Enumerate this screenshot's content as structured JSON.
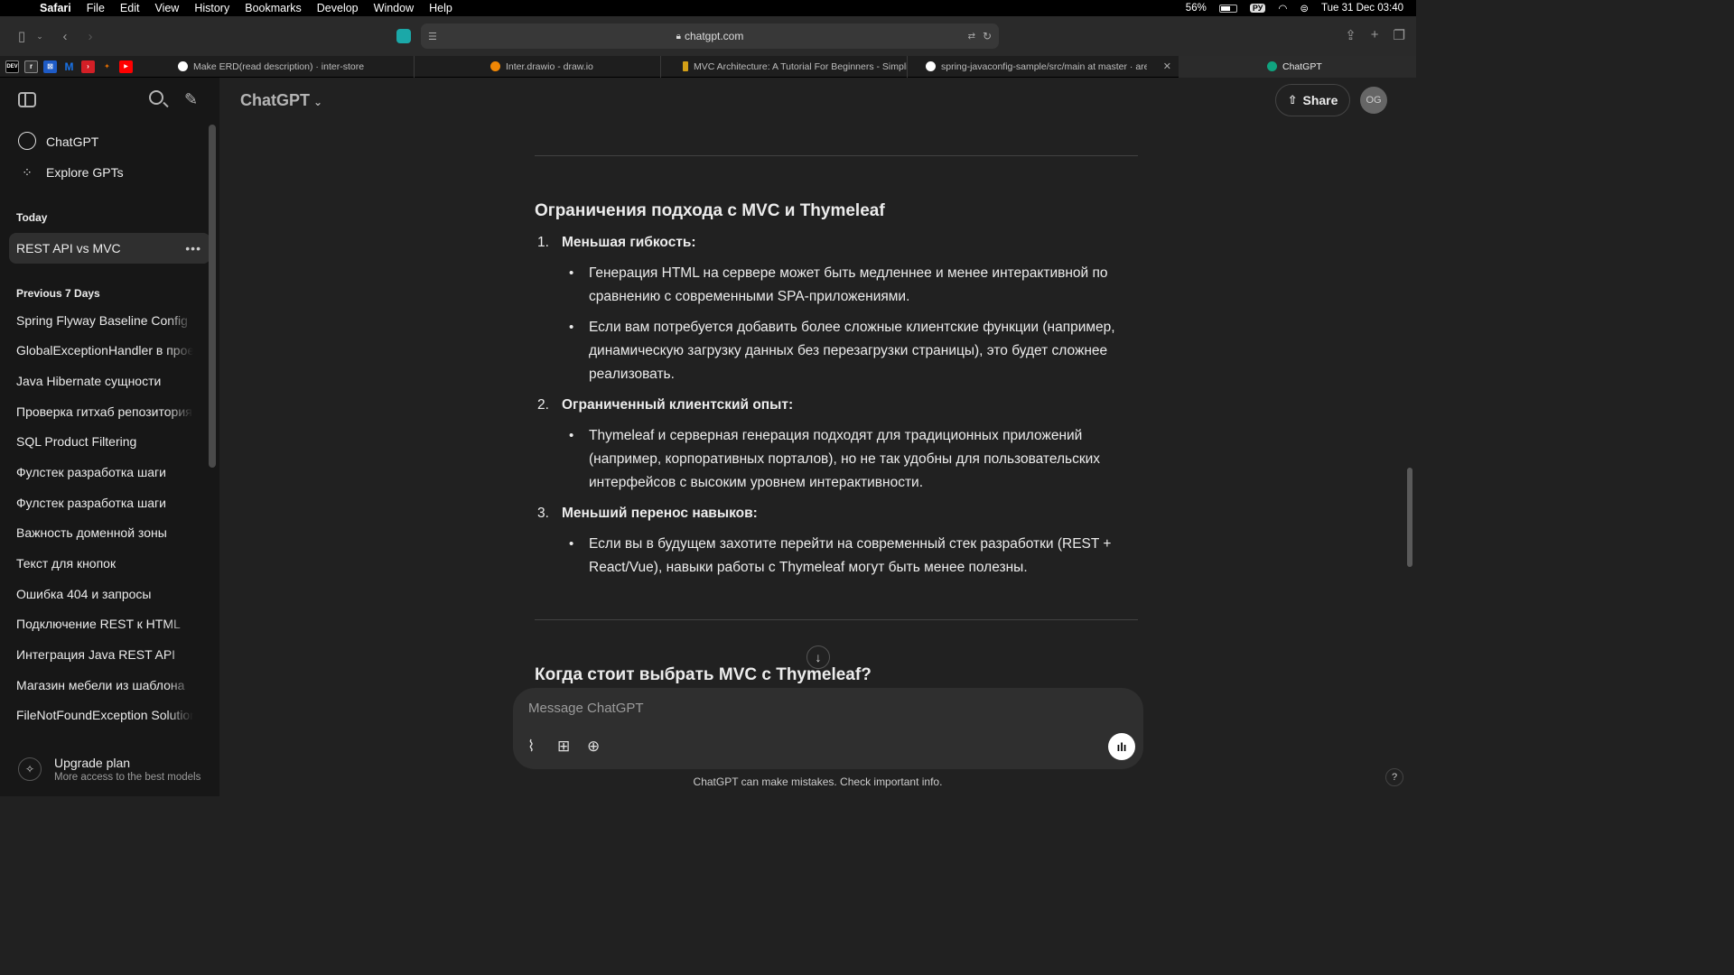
{
  "menubar": {
    "app": "Safari",
    "items": [
      "File",
      "Edit",
      "View",
      "History",
      "Bookmarks",
      "Develop",
      "Window",
      "Help"
    ],
    "battery": "56%",
    "input_source": "РУ",
    "datetime": "Tue 31 Dec  03:40"
  },
  "browser": {
    "url": "chatgpt.com",
    "favorites": [
      {
        "label": "DEV",
        "color": "#000000"
      },
      {
        "label": "r",
        "color": "#333333"
      },
      {
        "label": "⊠",
        "color": "#1e5bc6"
      },
      {
        "label": "M",
        "color": "#1a73e8"
      },
      {
        "label": "›",
        "color": "#d31f26"
      },
      {
        "label": "✦",
        "color": "#e06c00"
      },
      {
        "label": "▶",
        "color": "#ff0000"
      }
    ],
    "tabs": [
      {
        "title": "Make ERD(read description) · inter-store",
        "icon_color": "#ffffff"
      },
      {
        "title": "Inter.drawio - draw.io",
        "icon_color": "#f08705"
      },
      {
        "title": "MVC Architecture: A Tutorial For Beginners - Simplile…",
        "icon_color": "#d4a017"
      },
      {
        "title": "spring-javaconfig-sample/src/main at master · arey/s…",
        "icon_color": "#ffffff"
      },
      {
        "title": "ChatGPT",
        "icon_color": "#10a37f"
      }
    ]
  },
  "sidebar": {
    "nav": [
      {
        "label": "ChatGPT",
        "icon": "openai-logo-icon"
      },
      {
        "label": "Explore GPTs",
        "icon": "grid-icon"
      }
    ],
    "today_label": "Today",
    "today": [
      {
        "label": "REST API vs MVC",
        "active": true
      }
    ],
    "prev_label": "Previous 7 Days",
    "previous": [
      "Spring Flyway Baseline Config",
      "GlobalExceptionHandler в проекте",
      "Java Hibernate сущности",
      "Проверка гитхаб репозитория",
      "SQL Product Filtering",
      "Фулстек разработка шаги",
      "Фулстек разработка шаги",
      "Важность доменной зоны",
      "Текст для кнопок",
      "Ошибка 404 и запросы",
      "Подключение REST к HTML",
      "Интеграция Java REST API",
      "Магазин мебели из шаблона",
      "FileNotFoundException Solution"
    ],
    "upgrade": {
      "title": "Upgrade plan",
      "subtitle": "More access to the best models"
    }
  },
  "main": {
    "model": "ChatGPT",
    "share": "Share",
    "avatar": "OG",
    "heading1": "Ограничения подхода с MVC и Thymeleaf",
    "items": [
      {
        "num": "1.",
        "title": "Меньшая гибкость:",
        "bullets": [
          "Генерация HTML на сервере может быть медленнее и менее интерактивной по сравнению с современными SPA-приложениями.",
          "Если вам потребуется добавить более сложные клиентские функции (например, динамическую загрузку данных без перезагрузки страницы), это будет сложнее реализовать."
        ]
      },
      {
        "num": "2.",
        "title": "Ограниченный клиентский опыт:",
        "bullets": [
          "Thymeleaf и серверная генерация подходят для традиционных приложений (например, корпоративных порталов), но не так удобны для пользовательских интерфейсов с высоким уровнем интерактивности."
        ]
      },
      {
        "num": "3.",
        "title": "Меньший перенос навыков:",
        "bullets": [
          "Если вы в будущем захотите перейти на современный стек разработки (REST + React/Vue), навыки работы с Thymeleaf могут быть менее полезны."
        ]
      }
    ],
    "heading2": "Когда стоит выбрать MVC с Thymeleaf?",
    "composer_placeholder": "Message ChatGPT",
    "disclaimer": "ChatGPT can make mistakes. Check important info.",
    "help": "?"
  }
}
